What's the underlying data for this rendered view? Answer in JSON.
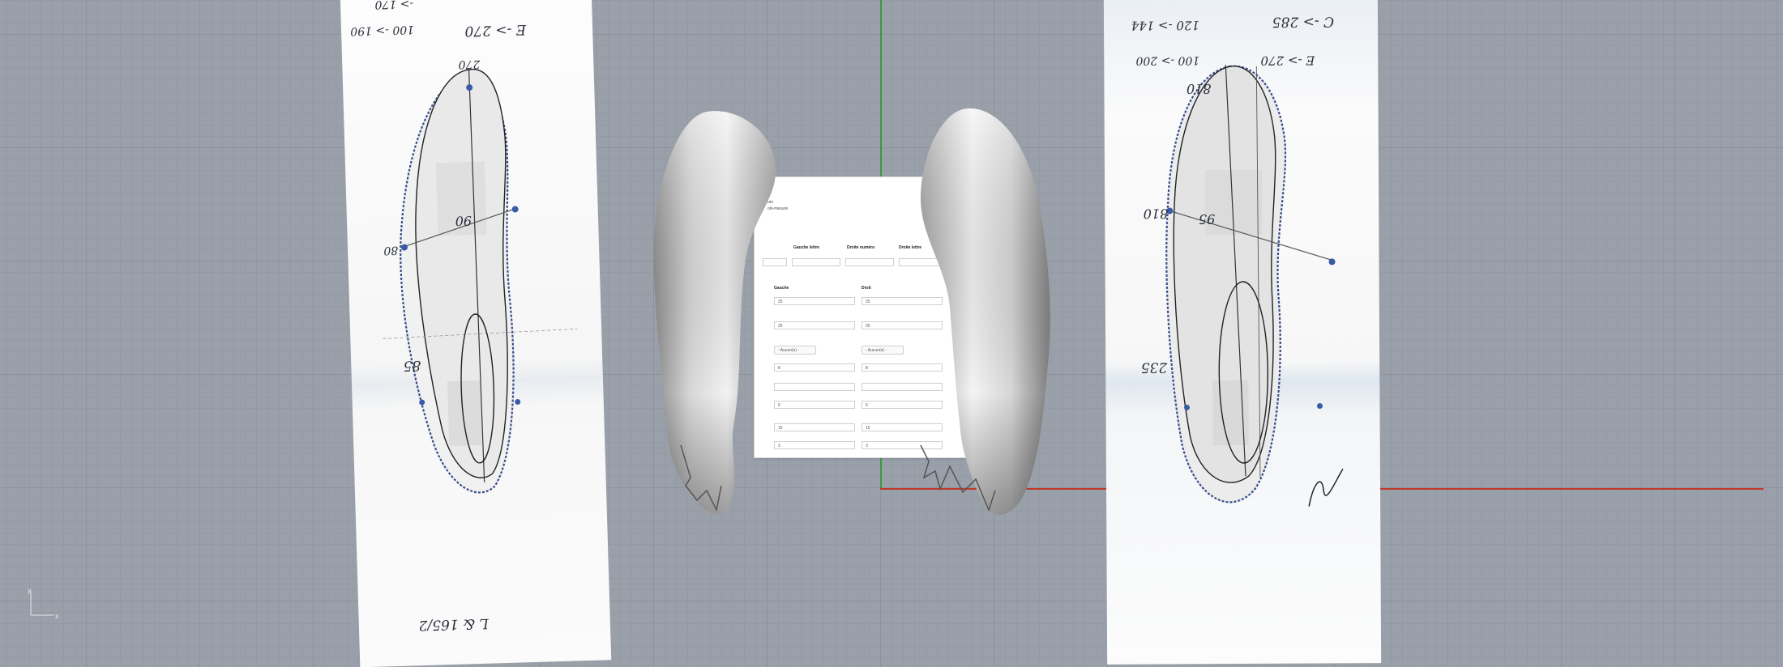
{
  "viewport": {
    "background": "#9aa0a9",
    "axis_x_color": "#c0392b",
    "axis_y_color": "#3c9a3c"
  },
  "corner_axes": {
    "x_label": "x",
    "y_label": "y"
  },
  "sheet_left": {
    "notes": [
      "E -> 270",
      "100 -> 190",
      "-> 170",
      "80",
      "90",
      "85",
      "270",
      "L & 165/2"
    ]
  },
  "sheet_right": {
    "notes": [
      "C -> 285",
      "120 -> 144",
      "100 -> 200",
      "E -> 270",
      "810",
      "810",
      "95",
      "235",
      "N"
    ]
  },
  "form_panel": {
    "header_line_1": "tle",
    "header_line_2": "um",
    "header_line_3": "olo-mesure",
    "col_gauche_lettre": "Gauche lettre",
    "col_droite_numero": "Droite numéro",
    "col_droite_lettre": "Droite lettre",
    "label_gauche": "Gauche",
    "label_droit": "Droit",
    "rows": [
      {
        "left": "25",
        "right": "25"
      },
      {
        "left": "25",
        "right": "25"
      },
      {
        "left": "- Aucun(e) -",
        "right": "- Aucun(e) -",
        "select": true
      },
      {
        "left": "8",
        "right": "8"
      },
      {
        "left": "",
        "right": ""
      },
      {
        "left": "6",
        "right": "6"
      },
      {
        "left": "15",
        "right": "15"
      },
      {
        "left": "3",
        "right": "3"
      }
    ]
  }
}
